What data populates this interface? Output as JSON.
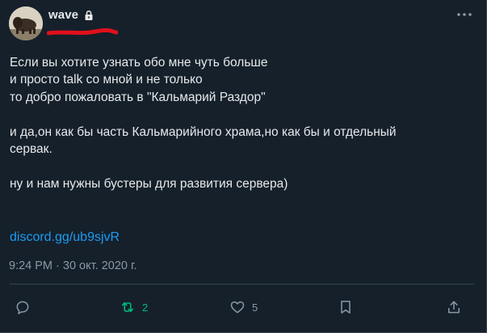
{
  "author": {
    "display_name": "wave",
    "protected_icon": "lock-icon",
    "avatar_icon": "bison-photo-avatar"
  },
  "menu_icon": "more-dots-icon",
  "tweet": {
    "line1": "Если вы хотите узнать обо мне чуть больше",
    "line2": "и просто talk со мной и не только",
    "line3": "то добро пожаловать в \"Кальмарий Раздор\"",
    "line4": "и да,он как бы часть Кальмарийного храма,но как бы и отдельный",
    "line5": "сервак.",
    "line6": "ну и нам нужны бустеры для развития сервера)",
    "link": "discord.gg/ub9sjvR",
    "timestamp": "9:24 PM · 30 окт. 2020 г."
  },
  "actions": {
    "reply_icon": "reply-icon",
    "retweet_icon": "retweet-icon",
    "retweet_count": "2",
    "like_icon": "heart-icon",
    "like_count": "5",
    "bookmark_icon": "bookmark-icon",
    "share_icon": "share-icon"
  },
  "colors": {
    "background": "#15202b",
    "text": "#e7e9ea",
    "muted": "#8b98a5",
    "link": "#1d9bf0",
    "retweet": "#00ba7c",
    "border": "#38444d",
    "redaction": "#e0101b"
  }
}
